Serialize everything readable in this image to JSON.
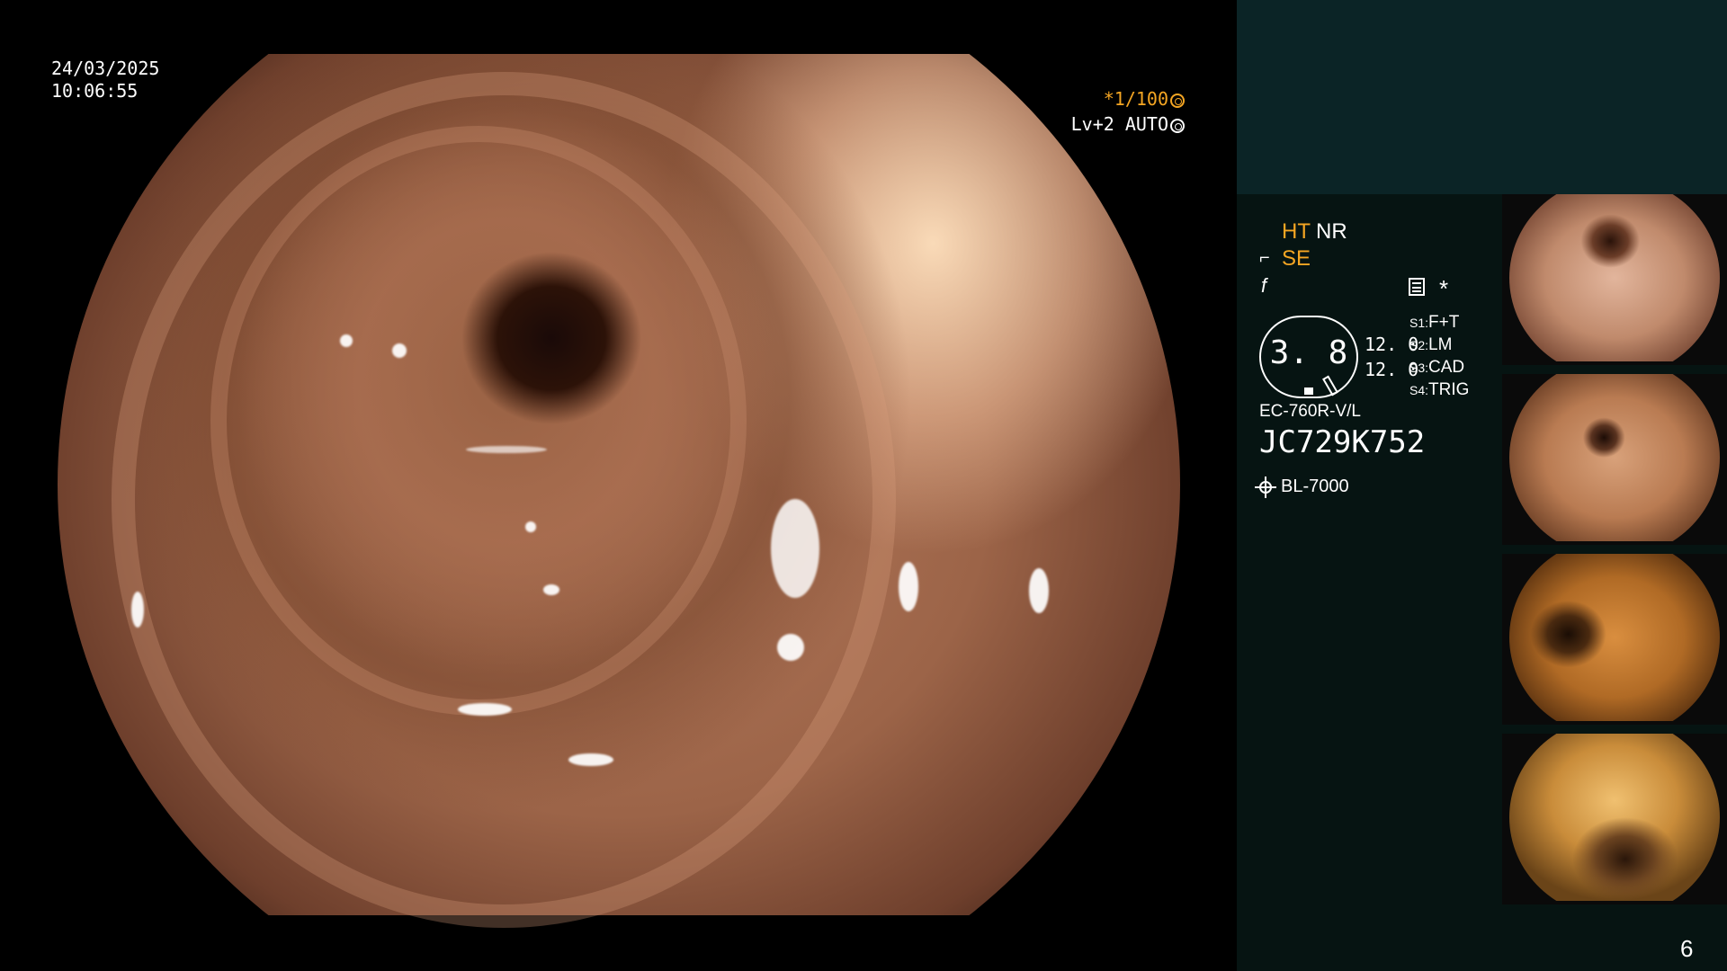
{
  "overlay": {
    "date": "24/03/2025",
    "time": "10:06:55",
    "shutter": "*1/100",
    "level": "Lv+2 AUTO"
  },
  "status": {
    "ht": "HT",
    "nr": "NR",
    "se": "SE",
    "star": "*"
  },
  "iris": {
    "value": "3. 8",
    "values": [
      "12. 0",
      "12. 0"
    ]
  },
  "switches": [
    {
      "key": "S1:",
      "value": "F+T"
    },
    {
      "key": "S2:",
      "value": "LM"
    },
    {
      "key": "S3:",
      "value": "CAD"
    },
    {
      "key": "S4:",
      "value": "TRIG"
    }
  ],
  "scope": {
    "model": "EC-760R-V/L",
    "serial": "JC729K752"
  },
  "light_source": "BL-7000",
  "page_number": "6",
  "colors": {
    "accent": "#f5a623",
    "panel_top": "#0b2426",
    "panel": "#061412"
  }
}
